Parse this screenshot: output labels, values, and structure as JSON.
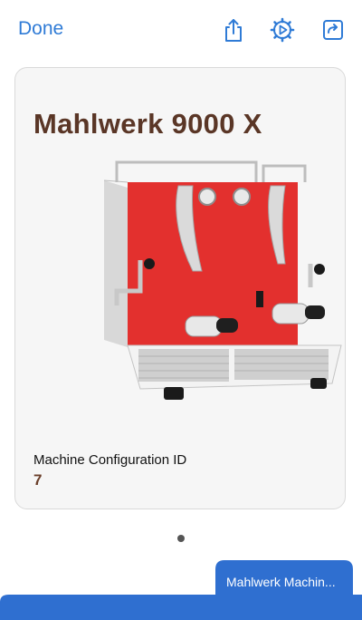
{
  "header": {
    "done_label": "Done",
    "icons": [
      "share-icon",
      "gear-play-icon",
      "external-link-icon"
    ],
    "accent_color": "#2f7bd6"
  },
  "card": {
    "title": "Mahlwerk 9000 X",
    "image": "espresso-machine-image",
    "config_label": "Machine Configuration ID",
    "config_value": "7"
  },
  "pager": {
    "current_page": 1,
    "page_count": 1
  },
  "bottom_tab": {
    "label": "Mahlwerk Machin...",
    "color": "#2f6fd0"
  }
}
